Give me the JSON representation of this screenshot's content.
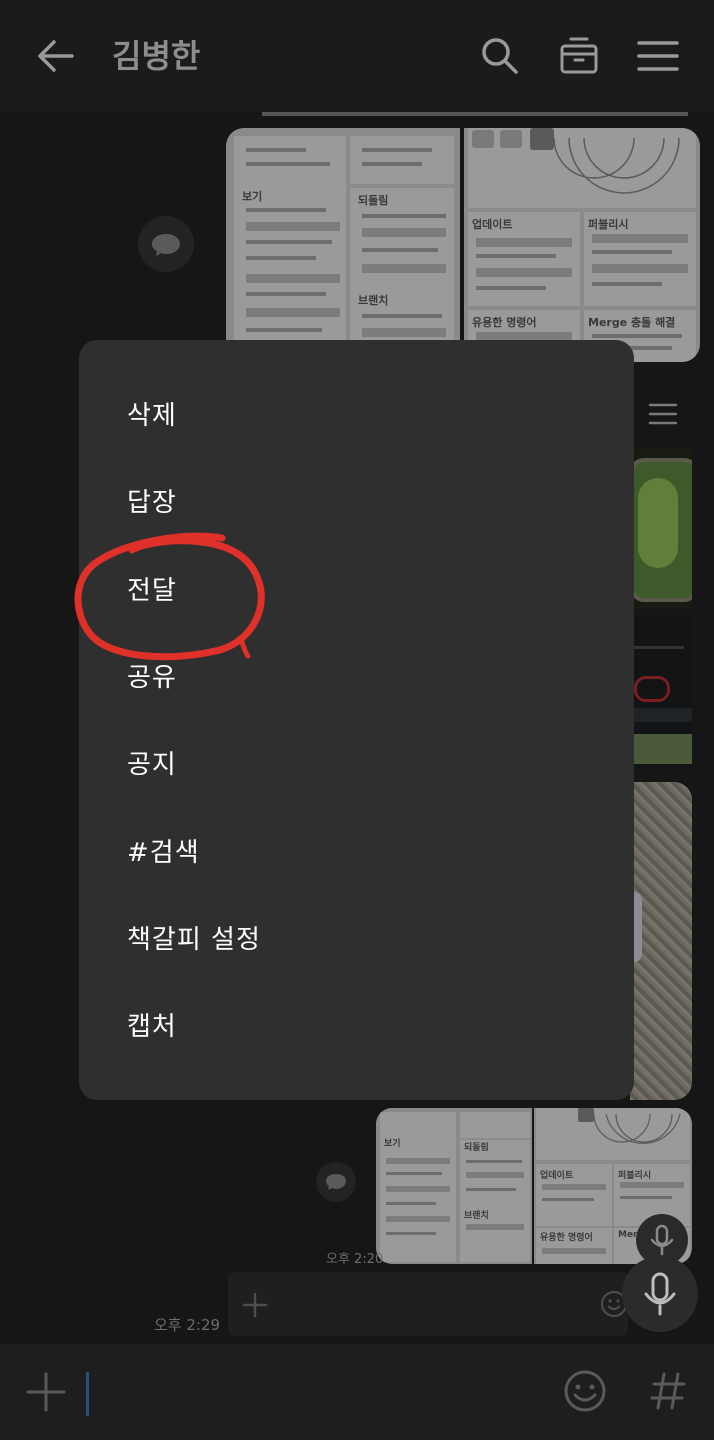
{
  "header": {
    "title": "김병한",
    "back_icon": "arrow-left-icon",
    "search_icon": "search-icon",
    "drawer_icon": "archive-box-icon",
    "menu_icon": "hamburger-menu-icon"
  },
  "thumbnails": {
    "top_left": {
      "sections": [
        "보기",
        "되돌림",
        "브랜치"
      ]
    },
    "top_right": {
      "sections": [
        "업데이트",
        "퍼블리시",
        "유용한 명령어",
        "Merge 충돌 해결"
      ]
    },
    "bottom_left": {
      "sections": [
        "보기",
        "되돌림",
        "브랜치"
      ]
    },
    "bottom_right": {
      "sections": [
        "업데이트",
        "퍼블리시",
        "유용한 명령어",
        "Merge"
      ]
    }
  },
  "timestamps": {
    "first": "오후 2:20",
    "second": "오후 2:29"
  },
  "context_menu": {
    "items": [
      "삭제",
      "답장",
      "전달",
      "공유",
      "공지",
      "#검색",
      "책갈피 설정",
      "캡처"
    ],
    "highlighted": "전달",
    "highlight_color": "#e0302a"
  },
  "colors": {
    "menu_bg": "#2f2f2f",
    "page_bg": "#161616"
  },
  "bottom_bar": {
    "plus_icon": "plus-icon",
    "emoji_icon": "emoji-face-icon",
    "hash_icon": "hashtag-icon"
  },
  "mic_icon": "microphone-icon"
}
